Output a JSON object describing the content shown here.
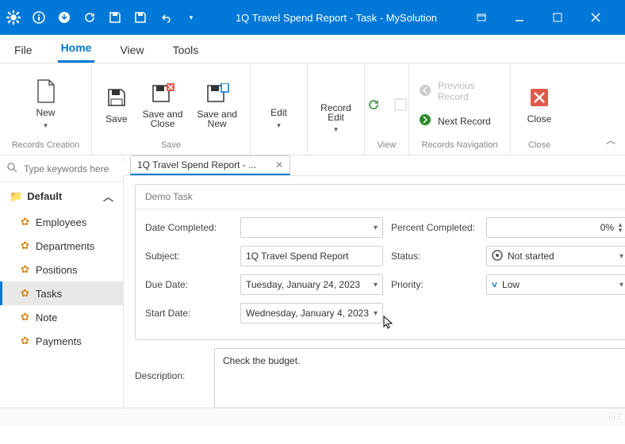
{
  "window": {
    "title": "1Q Travel Spend Report - Task - MySolution"
  },
  "menu": {
    "file": "File",
    "home": "Home",
    "view": "View",
    "tools": "Tools"
  },
  "ribbon": {
    "records_creation": {
      "label": "Records Creation",
      "new": "New"
    },
    "save_group": {
      "label": "Save",
      "save": "Save",
      "save_close": "Save and Close",
      "save_new": "Save and New"
    },
    "edit_group": {
      "edit": "Edit",
      "record_edit": "Record Edit"
    },
    "view_group": {
      "label": "View"
    },
    "nav_group": {
      "label": "Records Navigation",
      "prev": "Previous Record",
      "next": "Next Record"
    },
    "close_group": {
      "label": "Close",
      "close": "Close"
    }
  },
  "search": {
    "placeholder": "Type keywords here"
  },
  "sidebar": {
    "group": "Default",
    "items": [
      {
        "label": "Employees"
      },
      {
        "label": "Departments"
      },
      {
        "label": "Positions"
      },
      {
        "label": "Tasks"
      },
      {
        "label": "Note"
      },
      {
        "label": "Payments"
      }
    ]
  },
  "tab": {
    "title": "1Q Travel Spend Report - ..."
  },
  "form": {
    "title": "Demo Task",
    "labels": {
      "date_completed": "Date Completed:",
      "percent_completed": "Percent Completed:",
      "subject": "Subject:",
      "status": "Status:",
      "due_date": "Due Date:",
      "priority": "Priority:",
      "start_date": "Start Date:",
      "description": "Description:"
    },
    "values": {
      "date_completed": "",
      "percent_completed": "0%",
      "subject": "1Q Travel Spend Report",
      "status": "Not started",
      "due_date": "Tuesday, January 24, 2023",
      "priority": "Low",
      "start_date": "Wednesday, January 4, 2023",
      "description": "Check the budget."
    }
  }
}
